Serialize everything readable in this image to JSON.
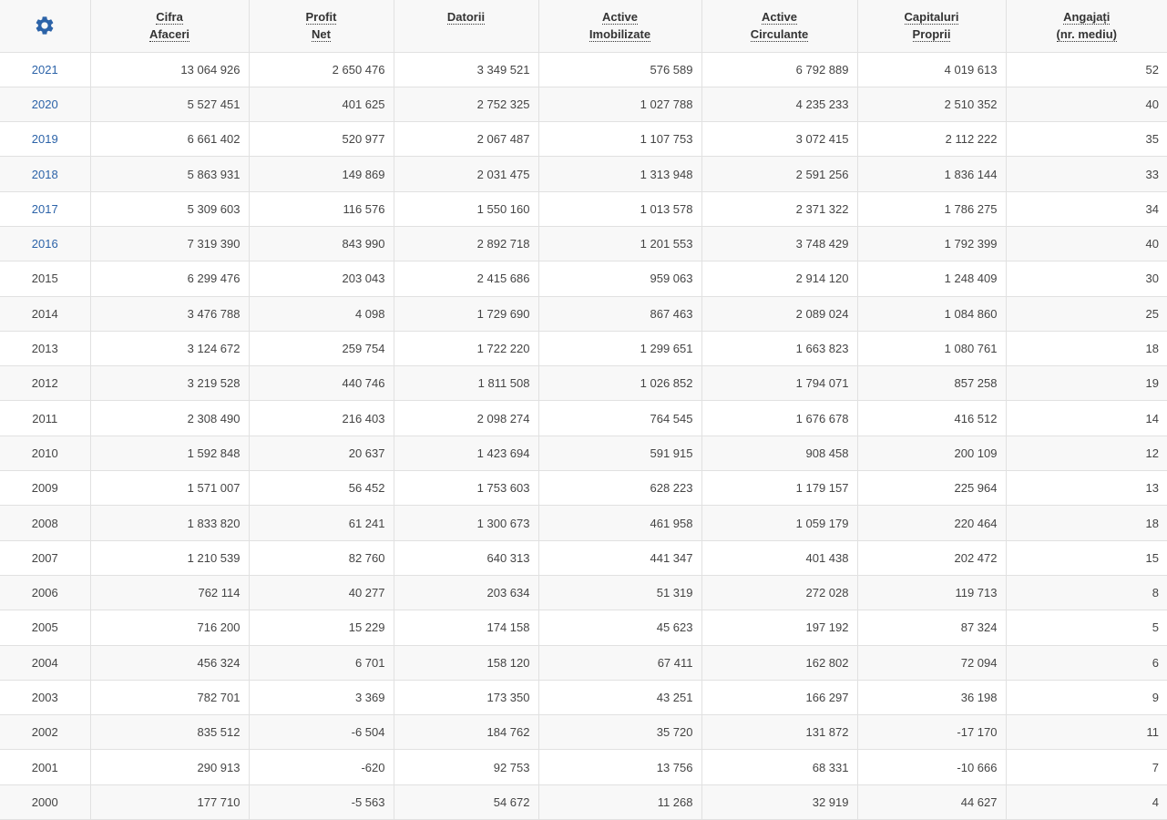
{
  "accent_color": "#2c63a8",
  "toolbar": {
    "settings_icon": "gear-icon"
  },
  "columns": [
    {
      "line1": "Cifra",
      "line2": "Afaceri"
    },
    {
      "line1": "Profit",
      "line2": "Net"
    },
    {
      "line1": "Datorii",
      "line2": ""
    },
    {
      "line1": "Active",
      "line2": "Imobilizate"
    },
    {
      "line1": "Active",
      "line2": "Circulante"
    },
    {
      "line1": "Capitaluri",
      "line2": "Proprii"
    },
    {
      "line1": "Angajați",
      "line2": "(nr. mediu)"
    }
  ],
  "rows": [
    {
      "year": "2021",
      "linked": true,
      "values": [
        "13 064 926",
        "2 650 476",
        "3 349 521",
        "576 589",
        "6 792 889",
        "4 019 613",
        "52"
      ]
    },
    {
      "year": "2020",
      "linked": true,
      "values": [
        "5 527 451",
        "401 625",
        "2 752 325",
        "1 027 788",
        "4 235 233",
        "2 510 352",
        "40"
      ]
    },
    {
      "year": "2019",
      "linked": true,
      "values": [
        "6 661 402",
        "520 977",
        "2 067 487",
        "1 107 753",
        "3 072 415",
        "2 112 222",
        "35"
      ]
    },
    {
      "year": "2018",
      "linked": true,
      "values": [
        "5 863 931",
        "149 869",
        "2 031 475",
        "1 313 948",
        "2 591 256",
        "1 836 144",
        "33"
      ]
    },
    {
      "year": "2017",
      "linked": true,
      "values": [
        "5 309 603",
        "116 576",
        "1 550 160",
        "1 013 578",
        "2 371 322",
        "1 786 275",
        "34"
      ]
    },
    {
      "year": "2016",
      "linked": true,
      "values": [
        "7 319 390",
        "843 990",
        "2 892 718",
        "1 201 553",
        "3 748 429",
        "1 792 399",
        "40"
      ]
    },
    {
      "year": "2015",
      "linked": false,
      "values": [
        "6 299 476",
        "203 043",
        "2 415 686",
        "959 063",
        "2 914 120",
        "1 248 409",
        "30"
      ]
    },
    {
      "year": "2014",
      "linked": false,
      "values": [
        "3 476 788",
        "4 098",
        "1 729 690",
        "867 463",
        "2 089 024",
        "1 084 860",
        "25"
      ]
    },
    {
      "year": "2013",
      "linked": false,
      "values": [
        "3 124 672",
        "259 754",
        "1 722 220",
        "1 299 651",
        "1 663 823",
        "1 080 761",
        "18"
      ]
    },
    {
      "year": "2012",
      "linked": false,
      "values": [
        "3 219 528",
        "440 746",
        "1 811 508",
        "1 026 852",
        "1 794 071",
        "857 258",
        "19"
      ]
    },
    {
      "year": "2011",
      "linked": false,
      "values": [
        "2 308 490",
        "216 403",
        "2 098 274",
        "764 545",
        "1 676 678",
        "416 512",
        "14"
      ]
    },
    {
      "year": "2010",
      "linked": false,
      "values": [
        "1 592 848",
        "20 637",
        "1 423 694",
        "591 915",
        "908 458",
        "200 109",
        "12"
      ]
    },
    {
      "year": "2009",
      "linked": false,
      "values": [
        "1 571 007",
        "56 452",
        "1 753 603",
        "628 223",
        "1 179 157",
        "225 964",
        "13"
      ]
    },
    {
      "year": "2008",
      "linked": false,
      "values": [
        "1 833 820",
        "61 241",
        "1 300 673",
        "461 958",
        "1 059 179",
        "220 464",
        "18"
      ]
    },
    {
      "year": "2007",
      "linked": false,
      "values": [
        "1 210 539",
        "82 760",
        "640 313",
        "441 347",
        "401 438",
        "202 472",
        "15"
      ]
    },
    {
      "year": "2006",
      "linked": false,
      "values": [
        "762 114",
        "40 277",
        "203 634",
        "51 319",
        "272 028",
        "119 713",
        "8"
      ]
    },
    {
      "year": "2005",
      "linked": false,
      "values": [
        "716 200",
        "15 229",
        "174 158",
        "45 623",
        "197 192",
        "87 324",
        "5"
      ]
    },
    {
      "year": "2004",
      "linked": false,
      "values": [
        "456 324",
        "6 701",
        "158 120",
        "67 411",
        "162 802",
        "72 094",
        "6"
      ]
    },
    {
      "year": "2003",
      "linked": false,
      "values": [
        "782 701",
        "3 369",
        "173 350",
        "43 251",
        "166 297",
        "36 198",
        "9"
      ]
    },
    {
      "year": "2002",
      "linked": false,
      "values": [
        "835 512",
        "-6 504",
        "184 762",
        "35 720",
        "131 872",
        "-17 170",
        "11"
      ]
    },
    {
      "year": "2001",
      "linked": false,
      "values": [
        "290 913",
        "-620",
        "92 753",
        "13 756",
        "68 331",
        "-10 666",
        "7"
      ]
    },
    {
      "year": "2000",
      "linked": false,
      "values": [
        "177 710",
        "-5 563",
        "54 672",
        "11 268",
        "32 919",
        "44 627",
        "4"
      ]
    }
  ]
}
